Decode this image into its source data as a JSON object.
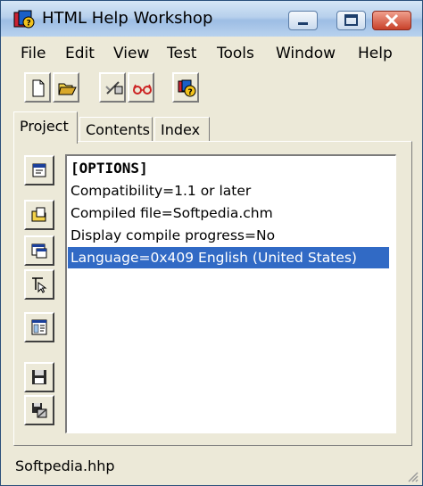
{
  "window": {
    "title": "HTML Help Workshop"
  },
  "menu": [
    "File",
    "Edit",
    "View",
    "Test",
    "Tools",
    "Window",
    "Help"
  ],
  "toolbar": {
    "buttons": [
      {
        "icon": "new-file-icon"
      },
      {
        "icon": "open-folder-icon"
      },
      {
        "icon": "compile-icon"
      },
      {
        "icon": "view-glasses-icon"
      },
      {
        "icon": "help-icon"
      }
    ]
  },
  "tabs": [
    {
      "label": "Project",
      "active": true
    },
    {
      "label": "Contents",
      "active": false
    },
    {
      "label": "Index",
      "active": false
    }
  ],
  "side_buttons": [
    {
      "icon": "change-options-icon"
    },
    {
      "icon": "add-remove-topic-files-icon"
    },
    {
      "icon": "add-modify-window-icon"
    },
    {
      "icon": "html-api-info-icon"
    },
    {
      "icon": "view-html-source-icon"
    },
    {
      "icon": "save-project-icon"
    },
    {
      "icon": "save-compile-icon"
    }
  ],
  "options_list": {
    "header": "[OPTIONS]",
    "lines": [
      "Compatibility=1.1 or later",
      "Compiled file=Softpedia.chm",
      "Display compile progress=No",
      "Language=0x409 English (United States)"
    ],
    "selected_index": 3
  },
  "status": {
    "file": "Softpedia.hhp"
  },
  "colors": {
    "selection": "#316ac5",
    "face": "#ece9d8"
  }
}
